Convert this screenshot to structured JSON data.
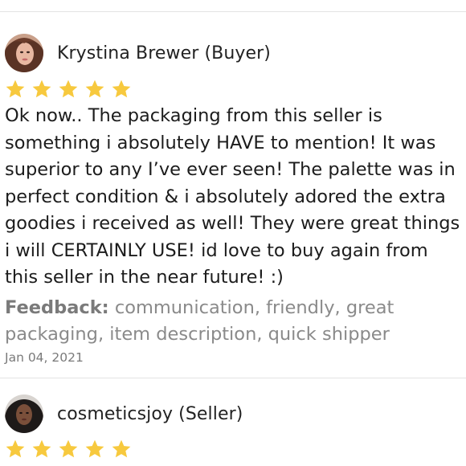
{
  "reviews": [
    {
      "reviewer_name": "Krystina Brewer (Buyer)",
      "rating": 5,
      "text": "Ok now.. The packaging from this seller is something i absolutely HAVE to mention! It was superior to any I’ve ever seen! The palette was in perfect condition & i absolutely adored the extra goodies i received as well! They were great things i will CERTAINLY USE! id love to buy again from this seller in the near future! :)",
      "feedback_label": "Feedback:",
      "feedback_value": "communication, friendly, great packaging, item description, quick shipper",
      "date": "Jan 04, 2021"
    },
    {
      "reviewer_name": "cosmeticsjoy (Seller)",
      "rating": 5
    }
  ],
  "colors": {
    "star": "#f7c93e",
    "divider": "#e3e3e3",
    "muted_text": "#8a8a8a"
  },
  "icons": {
    "star": "star-icon"
  }
}
